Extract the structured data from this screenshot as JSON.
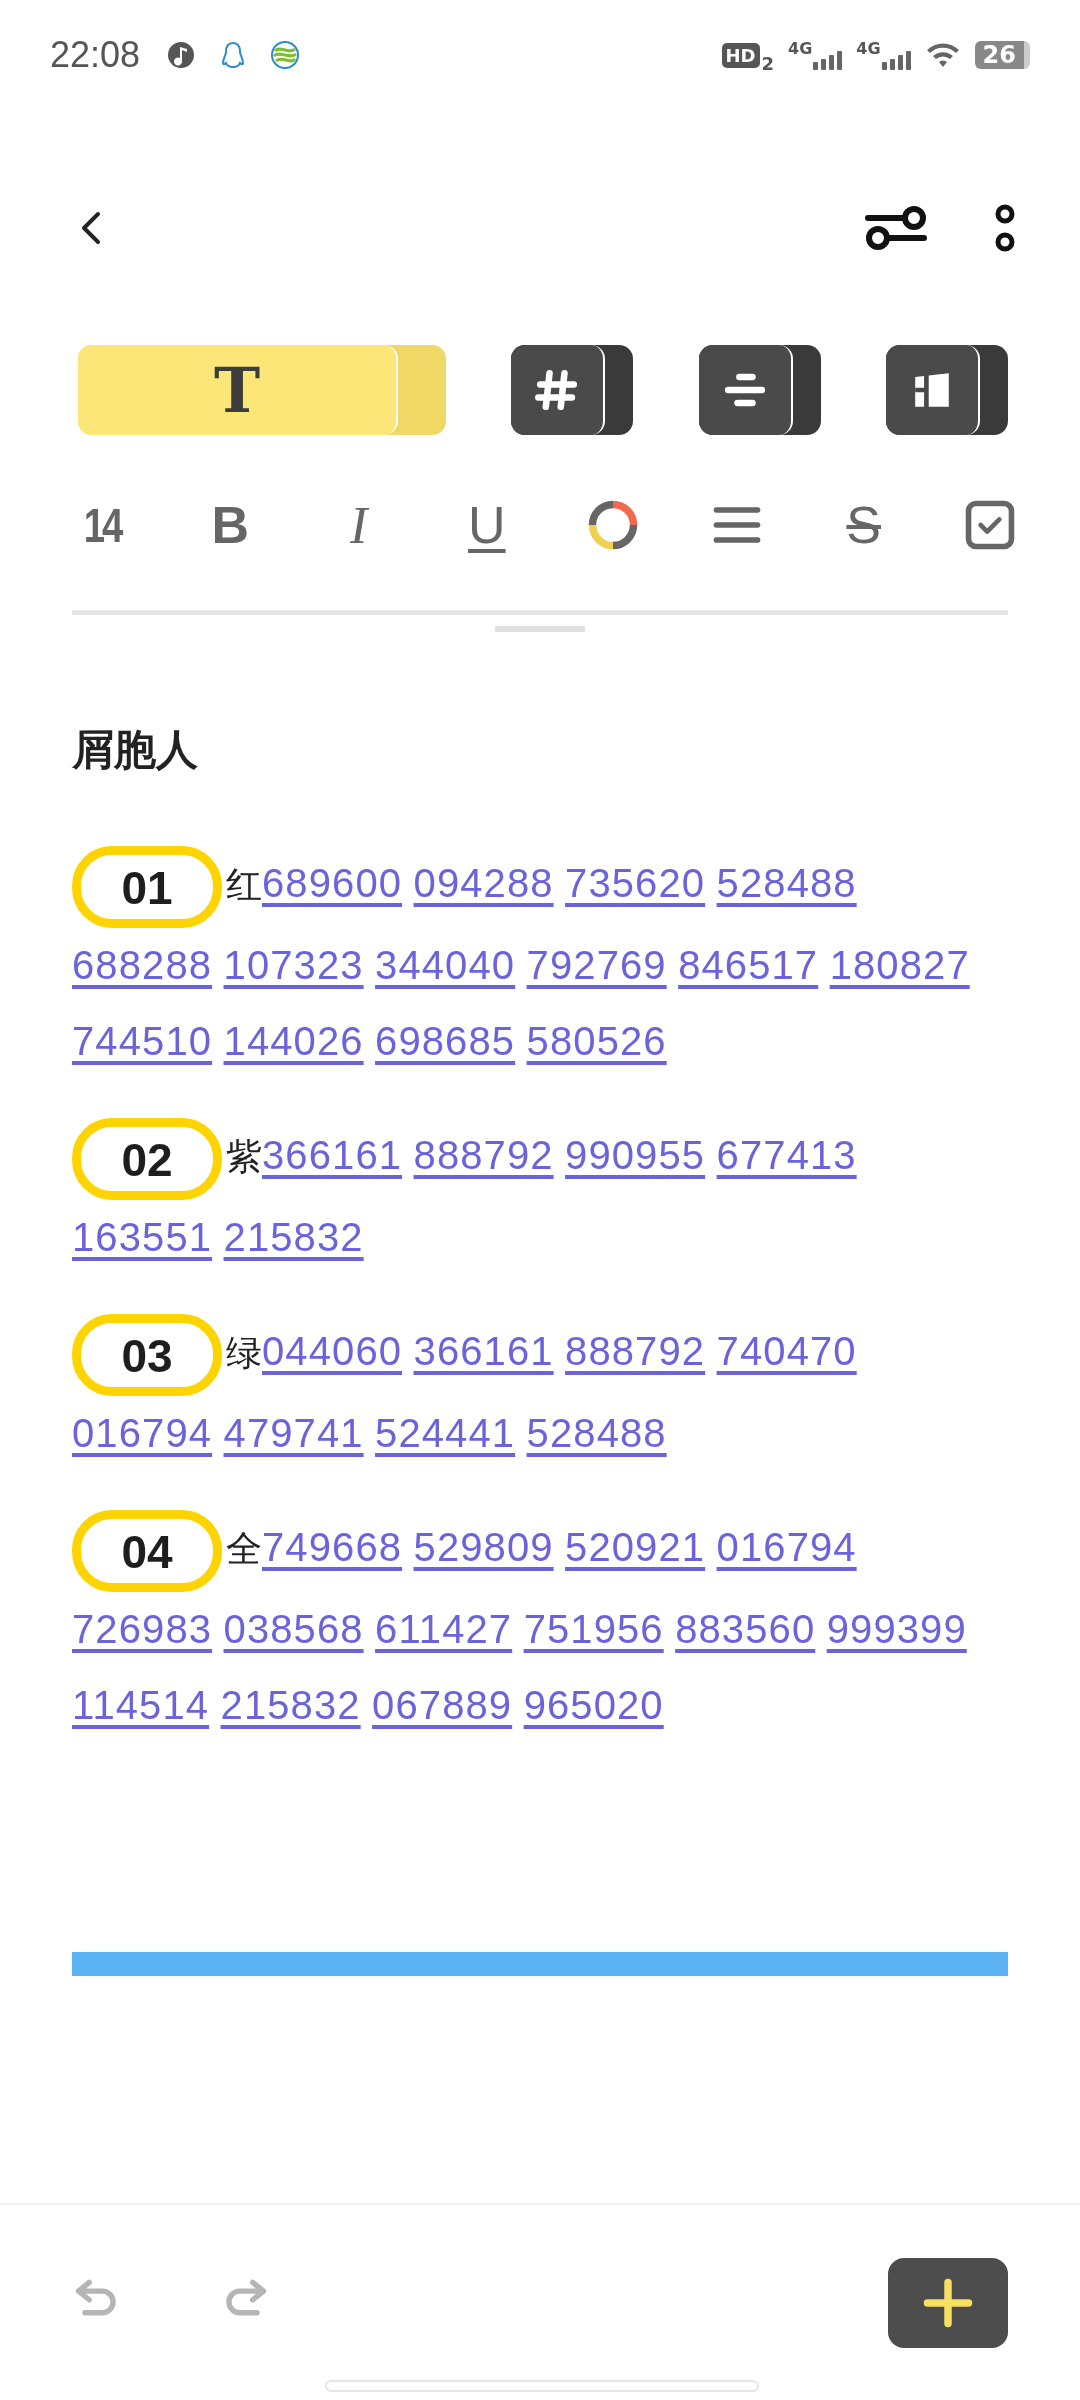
{
  "status_bar": {
    "time": "22:08",
    "hd": "HD",
    "hd_sim": "2",
    "networks": [
      "4G",
      "4G"
    ],
    "battery": "26"
  },
  "tools": [
    {
      "kind": "text",
      "label": "T",
      "selected": true
    },
    {
      "kind": "tag",
      "selected": false
    },
    {
      "kind": "list",
      "selected": false
    },
    {
      "kind": "layout",
      "selected": false
    }
  ],
  "format": [
    {
      "kind": "size",
      "label": "14"
    },
    {
      "kind": "bold",
      "label": "B"
    },
    {
      "kind": "italic",
      "label": "I"
    },
    {
      "kind": "underline",
      "label": "U"
    },
    {
      "kind": "color"
    },
    {
      "kind": "align"
    },
    {
      "kind": "strike",
      "label": "S"
    },
    {
      "kind": "checklist"
    }
  ],
  "note": {
    "title": "屑胞人",
    "groups": [
      {
        "badge": "01",
        "label": "红",
        "numbers": [
          "689600",
          "094288",
          "735620",
          "528488",
          "688288",
          "107323",
          "344040",
          "792769",
          "846517",
          "180827",
          "744510",
          "144026",
          "698685",
          "580526"
        ]
      },
      {
        "badge": "02",
        "label": "紫",
        "numbers": [
          "366161",
          "888792",
          "990955",
          "677413",
          "163551",
          "215832"
        ]
      },
      {
        "badge": "03",
        "label": "绿",
        "numbers": [
          "044060",
          "366161",
          "888792",
          "740470",
          "016794",
          "479741",
          "524441",
          "528488"
        ]
      },
      {
        "badge": "04",
        "label": "全",
        "numbers": [
          "749668",
          "529809",
          "520921",
          "016794",
          "726983",
          "038568",
          "611427",
          "751956",
          "883560",
          "999399",
          "114514",
          "215832",
          "067889",
          "965020"
        ]
      }
    ]
  },
  "bottom": {
    "undo": {
      "disabled": true
    },
    "redo": {
      "disabled": true
    }
  }
}
